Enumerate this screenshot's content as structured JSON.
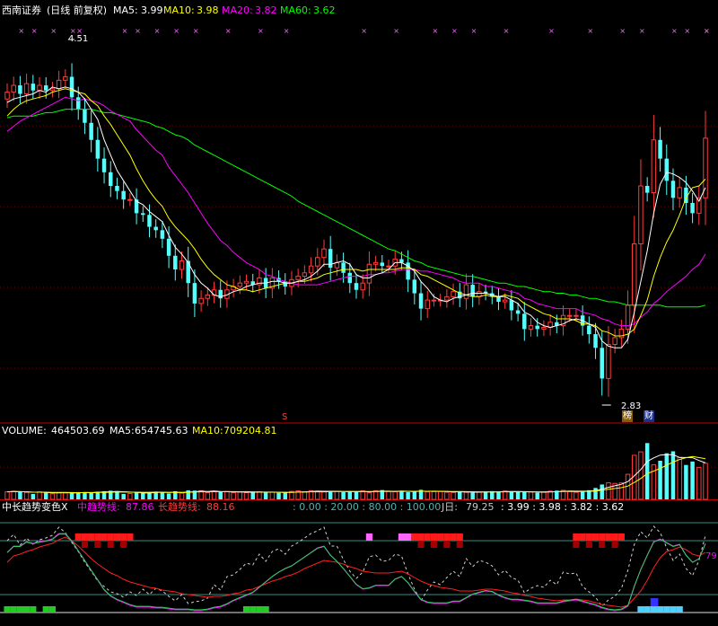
{
  "stock": {
    "name": "西南证券",
    "period": "(日线 前复权)"
  },
  "ma_legend": [
    {
      "label": "MA5:",
      "value": "3.99",
      "color": "#ffffff"
    },
    {
      "label": "MA10:",
      "value": "3.98",
      "color": "#ffff00"
    },
    {
      "label": "MA20:",
      "value": "3.82",
      "color": "#ff00ff"
    },
    {
      "label": "MA60:",
      "value": "3.62",
      "color": "#00ff00"
    }
  ],
  "annotations": {
    "high_label": "4.51",
    "low_label": "2.83",
    "marker_s": "S",
    "badge_bang": "榜",
    "badge_cai": "财"
  },
  "volume_legend": {
    "vol_label": "VOLUME:",
    "vol_value": "464503.69",
    "ma5_label": "MA5:",
    "ma5_value": "654745.63",
    "ma10_label": "MA10:",
    "ma10_value": "709204.81"
  },
  "indicator_legend": {
    "title": "中长趋势变色X",
    "mid_label": "中趋势线:",
    "mid_value": "87.86",
    "long_label": "长趋势线:",
    "long_value": "88.16",
    "levels": ": 0.00 : 20.00 : 80.00 : 100.00",
    "j_label": "J日:",
    "j_value": "79.25",
    "ma_values": ": 3.99 : 3.98 : 3.82 : 3.62",
    "right_value": "79"
  },
  "colors": {
    "up": "#ff3b3b",
    "down": "#54ffff",
    "ma5": "#ffffff",
    "ma10": "#ffff00",
    "ma20": "#ff00ff",
    "ma60": "#00ff00",
    "grid": "#8b0000"
  },
  "chart_data": {
    "type": "candlestick",
    "y_range_price": [
      2.6,
      4.75
    ],
    "closes": [
      4.42,
      4.46,
      4.41,
      4.47,
      4.43,
      4.46,
      4.43,
      4.44,
      4.49,
      4.51,
      4.39,
      4.32,
      4.24,
      4.14,
      4.03,
      3.95,
      3.87,
      3.84,
      3.79,
      3.79,
      3.71,
      3.7,
      3.63,
      3.61,
      3.56,
      3.46,
      3.38,
      3.43,
      3.3,
      3.18,
      3.21,
      3.23,
      3.26,
      3.21,
      3.26,
      3.28,
      3.3,
      3.31,
      3.29,
      3.33,
      3.27,
      3.33,
      3.31,
      3.28,
      3.32,
      3.34,
      3.36,
      3.4,
      3.45,
      3.5,
      3.39,
      3.42,
      3.36,
      3.3,
      3.26,
      3.3,
      3.41,
      3.42,
      3.4,
      3.4,
      3.44,
      3.42,
      3.32,
      3.24,
      3.15,
      3.2,
      3.2,
      3.2,
      3.22,
      3.25,
      3.21,
      3.29,
      3.22,
      3.25,
      3.24,
      3.22,
      3.19,
      3.2,
      3.14,
      3.12,
      3.03,
      3.05,
      3.03,
      3.04,
      3.07,
      3.05,
      3.11,
      3.11,
      3.11,
      3.05,
      3.0,
      2.92,
      2.74,
      2.94,
      2.98,
      3.03,
      3.17,
      3.53,
      3.87,
      3.83,
      4.14,
      4.03,
      3.9,
      3.8,
      3.86,
      3.77,
      3.71,
      3.8,
      4.15
    ],
    "ma5": [
      4.36,
      4.38,
      4.39,
      4.4,
      4.41,
      4.43,
      4.42,
      4.45,
      4.44,
      4.45,
      4.44,
      4.42,
      4.38,
      4.32,
      4.26,
      4.14,
      4.05,
      3.96,
      3.9,
      3.84,
      3.78,
      3.76,
      3.72,
      3.69,
      3.66,
      3.58,
      3.51,
      3.47,
      3.42,
      3.35,
      3.3,
      3.27,
      3.23,
      3.22,
      3.23,
      3.25,
      3.26,
      3.28,
      3.29,
      3.3,
      3.3,
      3.31,
      3.31,
      3.3,
      3.3,
      3.31,
      3.32,
      3.34,
      3.37,
      3.41,
      3.41,
      3.42,
      3.43,
      3.41,
      3.35,
      3.33,
      3.33,
      3.35,
      3.36,
      3.38,
      3.42,
      3.42,
      3.4,
      3.37,
      3.31,
      3.27,
      3.22,
      3.2,
      3.19,
      3.21,
      3.22,
      3.23,
      3.24,
      3.24,
      3.24,
      3.23,
      3.22,
      3.22,
      3.2,
      3.18,
      3.13,
      3.11,
      3.07,
      3.05,
      3.04,
      3.05,
      3.06,
      3.08,
      3.09,
      3.08,
      3.06,
      3.04,
      2.96,
      2.93,
      2.92,
      2.92,
      2.97,
      3.13,
      3.31,
      3.49,
      3.71,
      3.88,
      3.95,
      3.94,
      3.92,
      3.89,
      3.84,
      3.78,
      3.86
    ],
    "ma10": [
      4.28,
      4.32,
      4.35,
      4.37,
      4.38,
      4.39,
      4.4,
      4.42,
      4.43,
      4.44,
      4.43,
      4.42,
      4.41,
      4.37,
      4.34,
      4.28,
      4.23,
      4.17,
      4.11,
      4.05,
      3.97,
      3.9,
      3.84,
      3.79,
      3.75,
      3.68,
      3.63,
      3.59,
      3.55,
      3.5,
      3.44,
      3.39,
      3.35,
      3.32,
      3.29,
      3.28,
      3.26,
      3.26,
      3.25,
      3.26,
      3.27,
      3.28,
      3.29,
      3.3,
      3.3,
      3.31,
      3.31,
      3.32,
      3.33,
      3.35,
      3.36,
      3.37,
      3.38,
      3.38,
      3.38,
      3.37,
      3.38,
      3.38,
      3.38,
      3.38,
      3.38,
      3.39,
      3.39,
      3.38,
      3.35,
      3.34,
      3.32,
      3.3,
      3.28,
      3.26,
      3.24,
      3.23,
      3.22,
      3.22,
      3.23,
      3.22,
      3.22,
      3.23,
      3.22,
      3.21,
      3.18,
      3.16,
      3.14,
      3.12,
      3.11,
      3.09,
      3.09,
      3.09,
      3.08,
      3.06,
      3.06,
      3.05,
      3.02,
      3.01,
      2.99,
      2.99,
      3.0,
      3.03,
      3.11,
      3.2,
      3.34,
      3.45,
      3.54,
      3.61,
      3.7,
      3.8,
      3.86,
      3.87,
      3.91
    ],
    "ma20": [
      4.19,
      4.22,
      4.25,
      4.27,
      4.29,
      4.31,
      4.33,
      4.35,
      4.37,
      4.39,
      4.38,
      4.37,
      4.38,
      4.37,
      4.36,
      4.34,
      4.31,
      4.29,
      4.27,
      4.25,
      4.2,
      4.16,
      4.12,
      4.08,
      4.05,
      3.98,
      3.93,
      3.88,
      3.83,
      3.77,
      3.71,
      3.65,
      3.6,
      3.55,
      3.52,
      3.48,
      3.45,
      3.42,
      3.4,
      3.38,
      3.35,
      3.34,
      3.32,
      3.31,
      3.3,
      3.29,
      3.29,
      3.29,
      3.29,
      3.3,
      3.31,
      3.32,
      3.33,
      3.34,
      3.34,
      3.34,
      3.35,
      3.35,
      3.36,
      3.36,
      3.37,
      3.38,
      3.38,
      3.38,
      3.37,
      3.37,
      3.36,
      3.35,
      3.34,
      3.33,
      3.31,
      3.3,
      3.3,
      3.3,
      3.28,
      3.28,
      3.27,
      3.26,
      3.25,
      3.24,
      3.21,
      3.2,
      3.18,
      3.17,
      3.16,
      3.15,
      3.15,
      3.15,
      3.15,
      3.13,
      3.12,
      3.11,
      3.09,
      3.08,
      3.06,
      3.05,
      3.05,
      3.06,
      3.1,
      3.13,
      3.18,
      3.21,
      3.25,
      3.28,
      3.31,
      3.34,
      3.38,
      3.41,
      3.47
    ],
    "ma60": [
      4.27,
      4.28,
      4.28,
      4.28,
      4.28,
      4.29,
      4.3,
      4.3,
      4.31,
      4.32,
      4.32,
      4.32,
      4.32,
      4.32,
      4.31,
      4.3,
      4.3,
      4.29,
      4.28,
      4.27,
      4.26,
      4.25,
      4.24,
      4.22,
      4.21,
      4.19,
      4.17,
      4.16,
      4.14,
      4.11,
      4.09,
      4.07,
      4.05,
      4.03,
      4.01,
      3.99,
      3.97,
      3.95,
      3.93,
      3.91,
      3.89,
      3.87,
      3.85,
      3.83,
      3.81,
      3.78,
      3.76,
      3.74,
      3.72,
      3.7,
      3.68,
      3.66,
      3.64,
      3.62,
      3.6,
      3.58,
      3.56,
      3.54,
      3.52,
      3.5,
      3.49,
      3.47,
      3.45,
      3.43,
      3.42,
      3.4,
      3.39,
      3.38,
      3.37,
      3.36,
      3.35,
      3.34,
      3.34,
      3.33,
      3.32,
      3.31,
      3.3,
      3.3,
      3.29,
      3.28,
      3.28,
      3.27,
      3.26,
      3.25,
      3.25,
      3.24,
      3.24,
      3.23,
      3.23,
      3.22,
      3.21,
      3.21,
      3.2,
      3.19,
      3.19,
      3.18,
      3.17,
      3.17,
      3.17,
      3.17,
      3.17,
      3.17,
      3.16,
      3.16,
      3.16,
      3.16,
      3.16,
      3.16,
      3.17
    ],
    "volume": [
      0.57,
      0.61,
      0.57,
      0.53,
      0.41,
      0.57,
      0.53,
      0.42,
      0.51,
      0.49,
      0.51,
      0.55,
      0.54,
      0.49,
      0.58,
      0.61,
      0.65,
      0.62,
      0.41,
      0.44,
      0.51,
      0.5,
      0.55,
      0.58,
      0.52,
      0.45,
      0.61,
      0.47,
      0.68,
      0.66,
      0.65,
      0.51,
      0.62,
      0.55,
      0.59,
      0.5,
      0.55,
      0.51,
      0.55,
      0.58,
      0.51,
      0.54,
      0.49,
      0.51,
      0.6,
      0.64,
      0.58,
      0.65,
      0.62,
      0.57,
      0.63,
      0.59,
      0.54,
      0.57,
      0.59,
      0.64,
      0.5,
      0.65,
      0.7,
      0.6,
      0.57,
      0.63,
      0.54,
      0.59,
      0.72,
      0.56,
      0.59,
      0.59,
      0.54,
      0.53,
      0.6,
      0.53,
      0.5,
      0.55,
      0.58,
      0.62,
      0.58,
      0.62,
      0.59,
      0.55,
      0.56,
      0.55,
      0.5,
      0.55,
      0.62,
      0.66,
      0.68,
      0.6,
      0.53,
      0.61,
      0.69,
      0.86,
      1.12,
      1.25,
      1.2,
      1.24,
      1.89,
      3.32,
      3.58,
      4.24,
      2.61,
      2.91,
      3.47,
      3.62,
      3.16,
      2.59,
      2.85,
      2.41,
      2.72
    ],
    "j_line": [
      80,
      87,
      75,
      83,
      76,
      81,
      83,
      86,
      95,
      89,
      78,
      68,
      56,
      46,
      35,
      29,
      23,
      21,
      17,
      23,
      19,
      26,
      20,
      27,
      24,
      18,
      13,
      20,
      10,
      12,
      13,
      16,
      31,
      25,
      40,
      42,
      48,
      55,
      53,
      65,
      57,
      68,
      71,
      65,
      74,
      78,
      83,
      88,
      91,
      95,
      74,
      74,
      59,
      46,
      38,
      45,
      62,
      64,
      57,
      58,
      65,
      63,
      43,
      26,
      13,
      25,
      34,
      31,
      39,
      46,
      40,
      60,
      51,
      58,
      56,
      52,
      42,
      47,
      39,
      36,
      22,
      27,
      30,
      28,
      36,
      31,
      45,
      43,
      44,
      29,
      23,
      17,
      7,
      14,
      18,
      27,
      47,
      76,
      90,
      83,
      96,
      89,
      72,
      58,
      65,
      49,
      41,
      58,
      86
    ],
    "mid_line": [
      67,
      74,
      74,
      79,
      77,
      79,
      80,
      82,
      88,
      88,
      80,
      69,
      58,
      47,
      36,
      25,
      18,
      14,
      11,
      8,
      6,
      6,
      6,
      5,
      5,
      4,
      3,
      3,
      3,
      2,
      2,
      3,
      5,
      6,
      9,
      13,
      16,
      19,
      22,
      28,
      34,
      40,
      45,
      49,
      52,
      57,
      62,
      67,
      72,
      74,
      64,
      57,
      49,
      40,
      31,
      26,
      27,
      30,
      30,
      30,
      37,
      40,
      33,
      23,
      14,
      11,
      10,
      10,
      10,
      12,
      12,
      16,
      20,
      22,
      24,
      23,
      19,
      16,
      14,
      14,
      13,
      12,
      10,
      10,
      10,
      10,
      12,
      13,
      14,
      12,
      10,
      8,
      5,
      3,
      2,
      3,
      7,
      29,
      48,
      64,
      79,
      82,
      78,
      74,
      76,
      64,
      56,
      60,
      77
    ],
    "long_line": [
      56,
      63,
      65,
      68,
      70,
      73,
      75,
      77,
      81,
      84,
      80,
      74,
      67,
      60,
      54,
      49,
      44,
      41,
      37,
      34,
      32,
      30,
      28,
      27,
      25,
      24,
      23,
      21,
      20,
      19,
      18,
      17,
      18,
      18,
      19,
      21,
      22,
      25,
      26,
      29,
      32,
      35,
      37,
      40,
      42,
      45,
      49,
      52,
      55,
      58,
      57,
      56,
      54,
      51,
      49,
      46,
      45,
      44,
      44,
      44,
      45,
      46,
      43,
      39,
      35,
      32,
      30,
      28,
      27,
      26,
      24,
      24,
      24,
      25,
      26,
      26,
      25,
      24,
      22,
      21,
      19,
      18,
      16,
      15,
      14,
      13,
      14,
      14,
      15,
      14,
      13,
      11,
      9,
      8,
      7,
      6,
      8,
      16,
      24,
      36,
      50,
      61,
      68,
      70,
      73,
      70,
      65,
      63,
      67
    ]
  }
}
